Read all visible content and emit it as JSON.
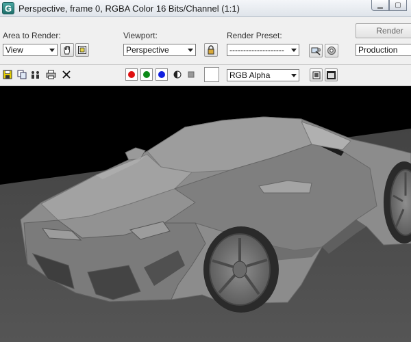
{
  "window": {
    "title": "Perspective, frame 0, RGBA Color 16 Bits/Channel (1:1)",
    "app_icon_letter": "G",
    "minimize_glyph": "▁",
    "maximize_glyph": "▢"
  },
  "panel": {
    "area_label": "Area to Render:",
    "area_value": "View",
    "viewport_label": "Viewport:",
    "viewport_value": "Perspective",
    "preset_label": "Render Preset:",
    "preset_value": "--------------------",
    "render_label": "Render",
    "mode_value": "Production"
  },
  "toolbar": {
    "channel_display": "RGB Alpha",
    "channels": [
      {
        "name": "red",
        "color": "#e01010"
      },
      {
        "name": "green",
        "color": "#0c8a18"
      },
      {
        "name": "blue",
        "color": "#1020e0"
      }
    ],
    "swatch_color": "#ffffff"
  },
  "colors": {
    "viewport_bg": "#000000",
    "ground": "#4e4e4e",
    "car_body": "#8a8a8a"
  },
  "icons": [
    "app-icon",
    "hand-icon",
    "region-icon",
    "lock-icon",
    "render-setup-icon",
    "gear-icon",
    "save-icon",
    "copy-icon",
    "clone-icon",
    "print-icon",
    "clear-icon",
    "alpha-icon",
    "mono-icon",
    "display-icon",
    "frame-window-icon"
  ]
}
